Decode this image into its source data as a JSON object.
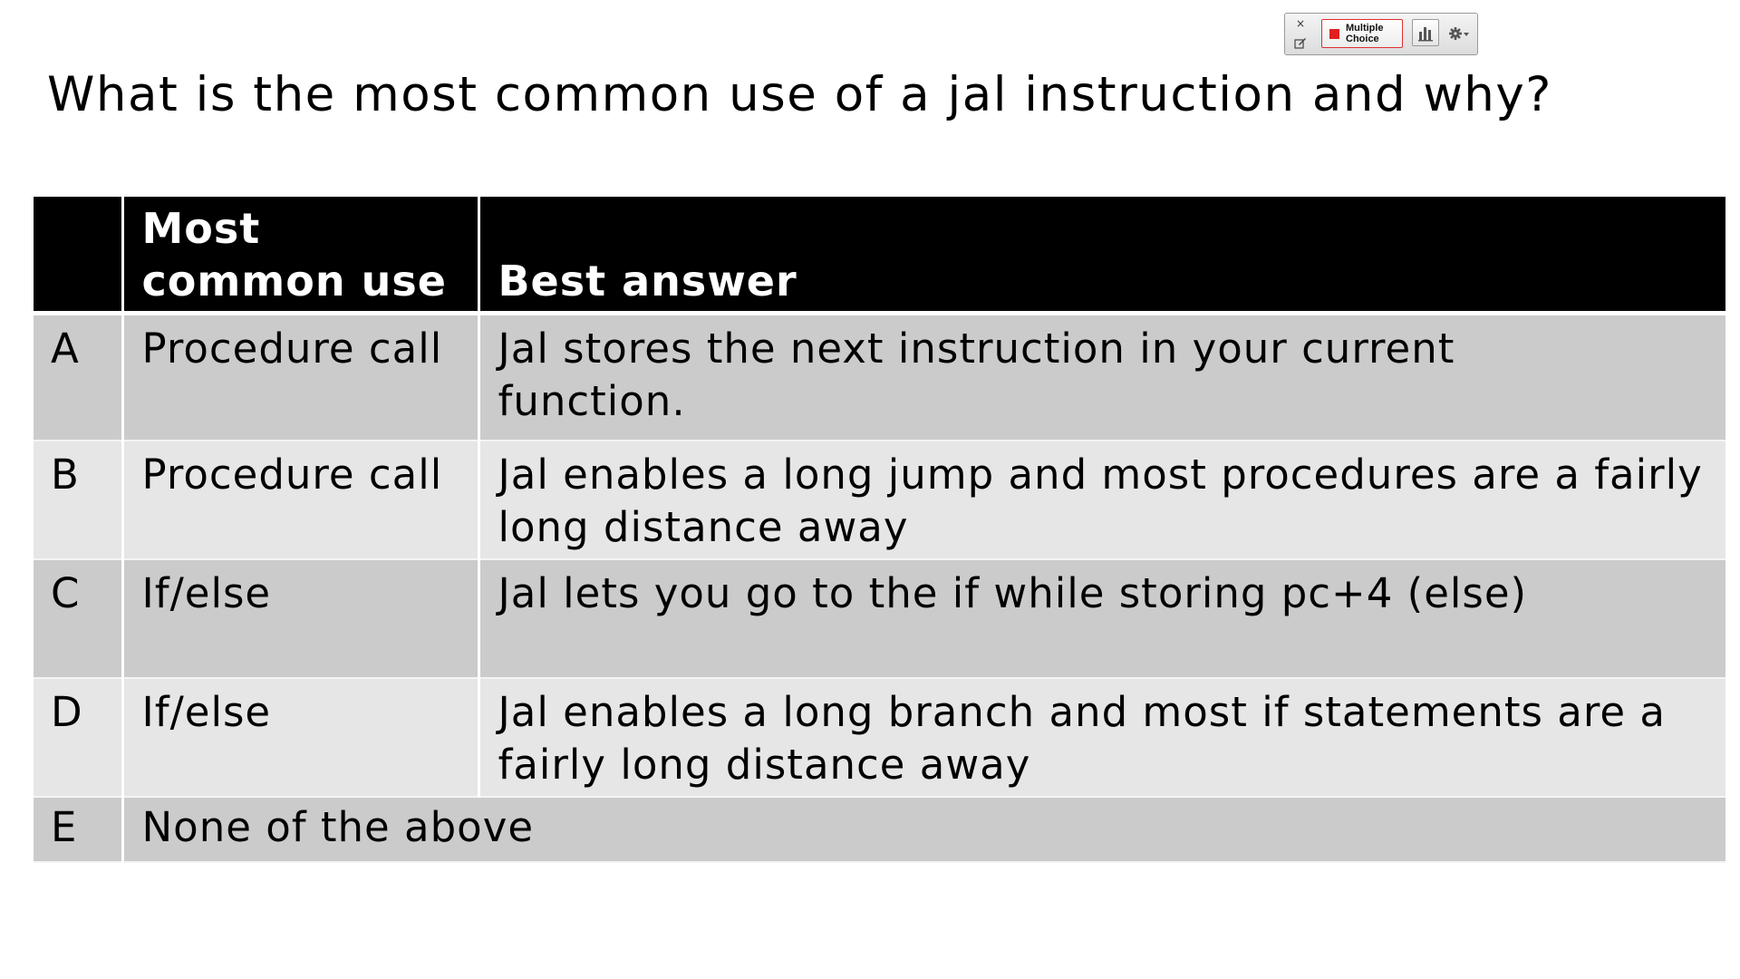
{
  "toolbar": {
    "close_glyph": "×",
    "mode_label": "Multiple\nChoice",
    "icons": [
      "close-icon",
      "edit-icon",
      "stop-square-icon",
      "bar-chart-icon",
      "gear-icon",
      "dropdown-arrow-icon"
    ],
    "mode_color": "#e02020"
  },
  "question": "What is the most common use of a jal instruction and why?",
  "table": {
    "headers": {
      "letter": "",
      "use": "Most\ncommon use",
      "answer": "Best answer"
    },
    "rows": [
      {
        "letter": "A",
        "use": "Procedure call",
        "answer": "Jal stores the next instruction in your current function."
      },
      {
        "letter": "B",
        "use": "Procedure call",
        "answer": "Jal enables a long jump and most procedures are a fairly long distance away"
      },
      {
        "letter": "C",
        "use": "If/else",
        "answer": "Jal lets you go to the if while storing pc+4 (else)"
      },
      {
        "letter": "D",
        "use": "If/else",
        "answer": "Jal enables a long branch and most if statements are a fairly long distance away"
      },
      {
        "letter": "E",
        "use": "None of the above",
        "answer": ""
      }
    ],
    "colors": {
      "header_bg": "#000000",
      "row_dark": "#cbcbcb",
      "row_light": "#e6e6e6"
    }
  }
}
